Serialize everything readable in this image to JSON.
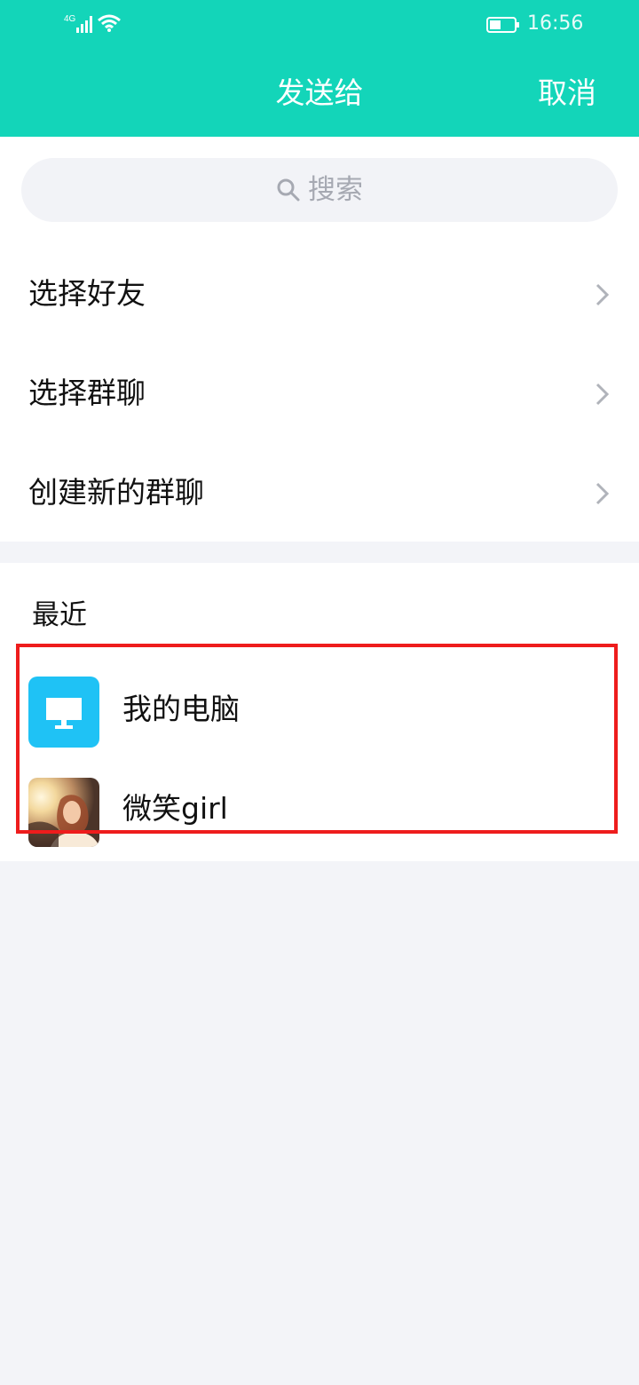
{
  "status_bar": {
    "network": "4G",
    "time": "16:56",
    "icons": [
      "signal-icon",
      "wifi-icon",
      "battery-icon"
    ]
  },
  "header": {
    "title": "发送给",
    "cancel_label": "取消",
    "background_color": "#13d5b9"
  },
  "search": {
    "placeholder": "搜索",
    "icon": "search-icon"
  },
  "menu": {
    "items": [
      {
        "label": "选择好友",
        "icon": "chevron-right-icon"
      },
      {
        "label": "选择群聊",
        "icon": "chevron-right-icon"
      },
      {
        "label": "创建新的群聊",
        "icon": "chevron-right-icon"
      }
    ]
  },
  "recent": {
    "title": "最近",
    "contacts": [
      {
        "name": "我的电脑",
        "avatar": "computer-icon",
        "avatar_color": "#1fc2f5"
      },
      {
        "name": "微笑girl",
        "avatar": "photo-avatar"
      }
    ]
  },
  "annotation": {
    "highlight_color": "#ee1c1c"
  }
}
